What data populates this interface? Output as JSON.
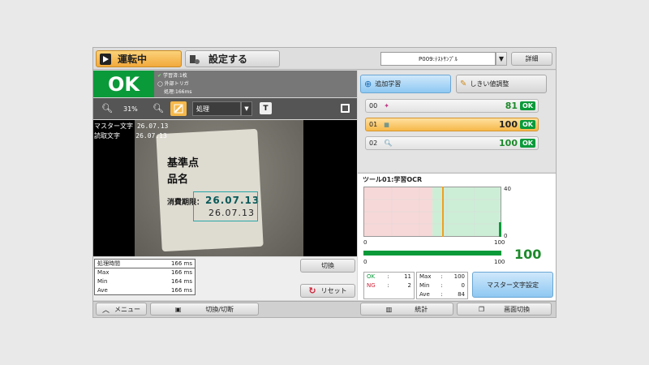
{
  "header": {
    "running_label": "運転中",
    "settings_label": "設定する",
    "program": "P009:ﾃｽﾄｻﾝﾌﾟﾙ",
    "details_label": "詳細"
  },
  "status": {
    "result": "OK",
    "line1": "学習済:1枚",
    "line2": "外部トリガ",
    "line3": "処理:166ms"
  },
  "viewer": {
    "zoom": "31%",
    "mode": "処理",
    "master_label": "マスター文字",
    "master_value": "26.07.13",
    "read_label": "読取文字",
    "read_value": "26.07.13",
    "card_line1": "基準点",
    "card_line2": "品名",
    "card_line3": "消費期限：",
    "card_date1": "26.07.13",
    "card_date2": "26.07.13"
  },
  "timing": {
    "rows": [
      {
        "label": "処理時間",
        "value": "166 ms"
      },
      {
        "label": "Max",
        "value": "166 ms"
      },
      {
        "label": "Min",
        "value": "164 ms"
      },
      {
        "label": "Ave",
        "value": "166 ms"
      }
    ],
    "switch_label": "切換",
    "reset_label": "リセット"
  },
  "tools": {
    "add_learning": "追加学習",
    "threshold": "しきい値調整",
    "items": [
      {
        "id": "00",
        "value": "81",
        "status": "OK"
      },
      {
        "id": "01",
        "value": "100",
        "status": "OK"
      },
      {
        "id": "02",
        "value": "100",
        "status": "OK"
      }
    ]
  },
  "graph": {
    "title": "ツール01:学習OCR",
    "y_max": "40",
    "y_min": "0",
    "x_min": "0",
    "x_max": "100",
    "bar_min": "0",
    "bar_max": "100",
    "value": "100",
    "threshold_fraction": 0.57
  },
  "stats": {
    "ok_label": "OK",
    "ok_value": "11",
    "ng_label": "NG",
    "ng_value": "2",
    "max_label": "Max",
    "max_value": "100",
    "min_label": "Min",
    "min_value": "0",
    "ave_label": "Ave",
    "ave_value": "84",
    "master_set": "マスター文字設定"
  },
  "footer": {
    "menu": "メニュー",
    "switch_cut": "切換/切断",
    "stats": "統計",
    "screen_switch": "画面切換"
  },
  "colors": {
    "ok_green": "#0a9a3a",
    "accent_orange": "#f6b84a",
    "accent_blue": "#9ecff5"
  }
}
